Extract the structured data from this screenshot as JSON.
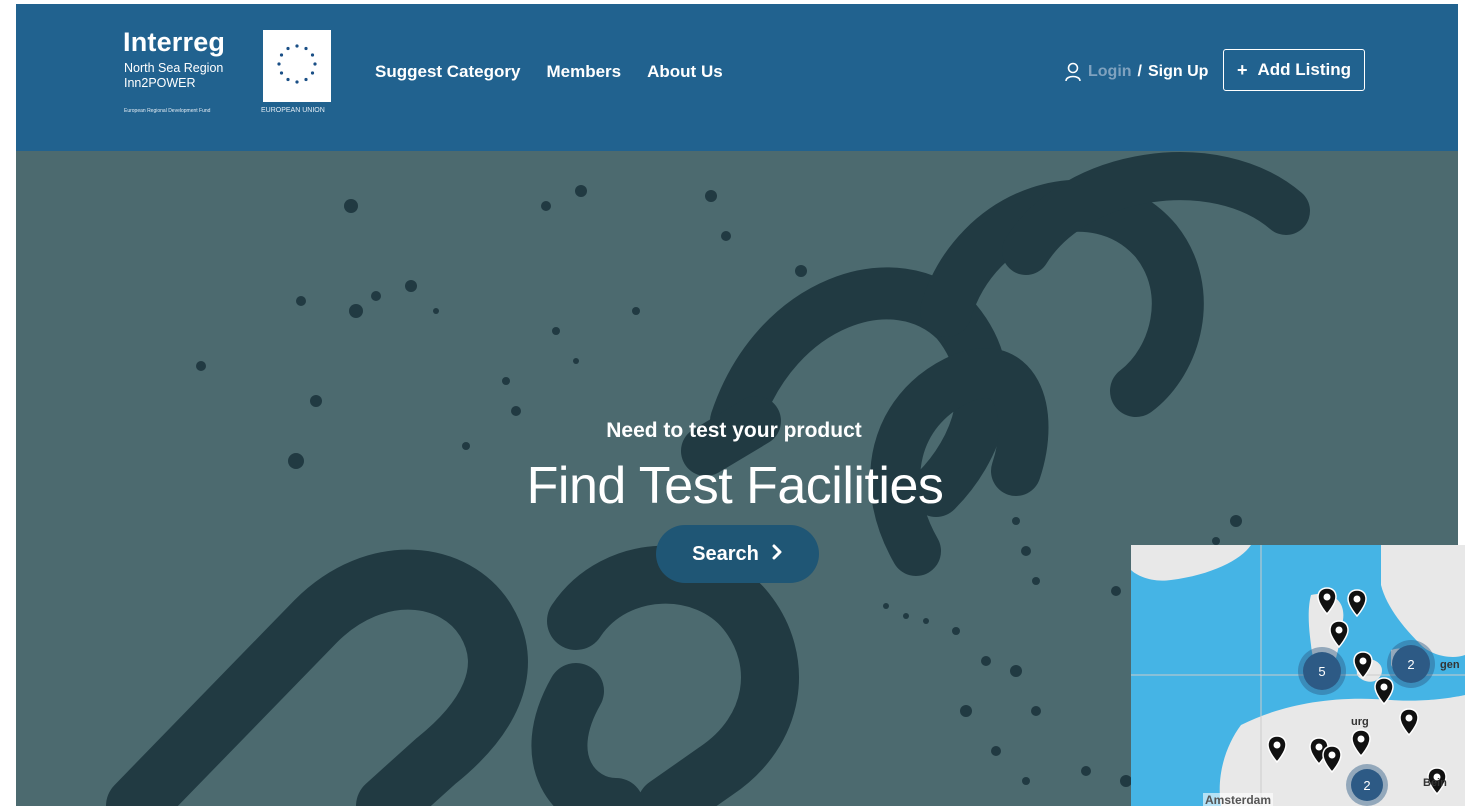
{
  "header": {
    "logo": {
      "brand": "Interreg",
      "line1": "North Sea Region",
      "line2": "Inn2POWER",
      "fund": "European Regional Development Fund",
      "eu_label": "EUROPEAN UNION"
    },
    "nav": [
      {
        "label": "Suggest Category"
      },
      {
        "label": "Members"
      },
      {
        "label": "About Us"
      }
    ],
    "account": {
      "icon": "user-icon",
      "login_label": "Login",
      "separator": "/",
      "signup_label": "Sign Up"
    },
    "add_listing": {
      "plus": "+",
      "label": "Add Listing"
    }
  },
  "hero": {
    "tagline": "Need to test your product",
    "title": "Find Test Facilities",
    "search_label": "Search",
    "search_icon": "chevron-right-icon"
  },
  "map": {
    "cities": {
      "amsterdam": "Amsterdam",
      "hamburg": "urg",
      "berlin": "Bein",
      "copenhagen": "gen"
    },
    "clusters": [
      "5",
      "2",
      "2"
    ]
  },
  "colors": {
    "header_bg": "#21628f",
    "hero_overlay": "#4c6a6f",
    "search_button": "#1f5675",
    "map_water": "#45b4e5",
    "cluster": "#2d5a85"
  }
}
